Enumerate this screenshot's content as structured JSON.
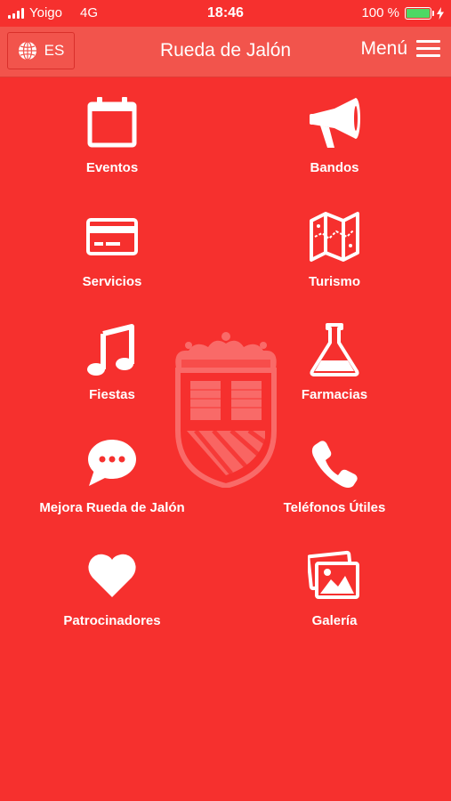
{
  "status_bar": {
    "carrier": "Yoigo",
    "network": "4G",
    "time": "18:46",
    "battery_percent": "100 %",
    "battery_level": 1.0
  },
  "nav": {
    "language": "ES",
    "title": "Rueda de Jalón",
    "menu_label": "Menú"
  },
  "grid": [
    {
      "label": "Eventos",
      "icon": "calendar-icon"
    },
    {
      "label": "Bandos",
      "icon": "megaphone-icon"
    },
    {
      "label": "Servicios",
      "icon": "credit-card-icon"
    },
    {
      "label": "Turismo",
      "icon": "map-icon"
    },
    {
      "label": "Fiestas",
      "icon": "music-note-icon"
    },
    {
      "label": "Farmacias",
      "icon": "flask-icon"
    },
    {
      "label": "Mejora Rueda de Jalón",
      "icon": "chat-bubble-icon"
    },
    {
      "label": "Teléfonos Útiles",
      "icon": "phone-icon"
    },
    {
      "label": "Patrocinadores",
      "icon": "heart-icon"
    },
    {
      "label": "Galería",
      "icon": "photos-icon"
    }
  ],
  "colors": {
    "background": "#f6302e",
    "nav_background": "#f2544c",
    "battery": "#4cd964"
  }
}
